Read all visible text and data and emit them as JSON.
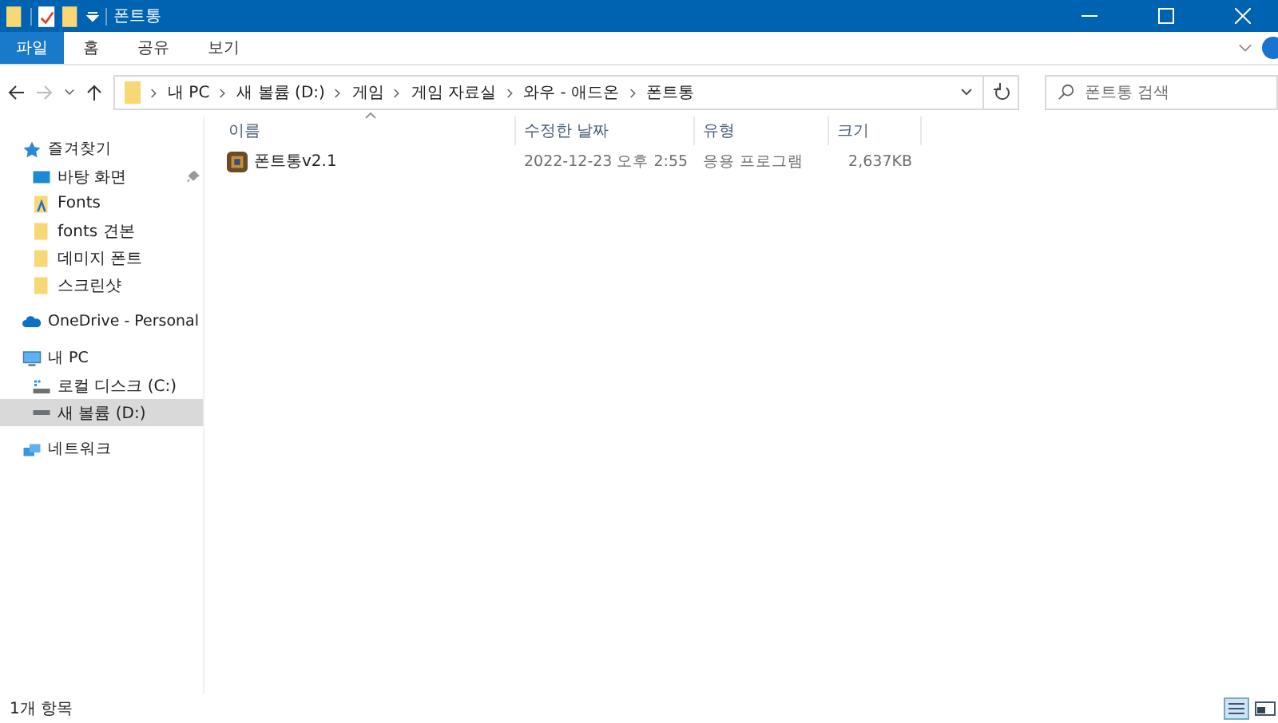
{
  "window": {
    "title": "폰트통"
  },
  "ribbon_tabs": [
    {
      "label": "파일",
      "selected": true
    },
    {
      "label": "홈",
      "selected": false
    },
    {
      "label": "공유",
      "selected": false
    },
    {
      "label": "보기",
      "selected": false
    }
  ],
  "address_bar": {
    "path": [
      "내 PC",
      "새 볼륨 (D:)",
      "게임",
      "게임 자료실",
      "와우 - 애드온",
      "폰트통"
    ]
  },
  "search": {
    "placeholder": "폰트통 검색"
  },
  "sidebar": {
    "items": [
      {
        "label": "즐겨찾기",
        "kind": "star",
        "selected": false,
        "children": [
          {
            "label": "바탕 화면",
            "kind": "desktop",
            "selected": false,
            "pinned": true
          },
          {
            "label": "Fonts",
            "kind": "font-folder",
            "selected": false,
            "pinned": false
          },
          {
            "label": "fonts  견본",
            "kind": "folder",
            "selected": false,
            "pinned": false
          },
          {
            "label": "데미지 폰트",
            "kind": "folder",
            "selected": false,
            "pinned": false
          },
          {
            "label": "스크린샷",
            "kind": "folder",
            "selected": false,
            "pinned": false
          }
        ]
      },
      {
        "label": "OneDrive - Personal",
        "kind": "cloud",
        "selected": false
      },
      {
        "label": "내 PC",
        "kind": "pc",
        "selected": false,
        "children": [
          {
            "label": "로컬 디스크 (C:)",
            "kind": "disk-system",
            "selected": false,
            "pinned": false
          },
          {
            "label": "새 볼륨 (D:)",
            "kind": "disk",
            "selected": true,
            "pinned": false
          }
        ]
      },
      {
        "label": "네트워크",
        "kind": "network",
        "selected": false
      }
    ]
  },
  "table": {
    "columns": [
      "이름",
      "수정한 날짜",
      "유형",
      "크기"
    ],
    "rows": [
      {
        "name": "폰트통v2.1",
        "modified": "2022-12-23 오후 2:55",
        "type": "응용 프로그램",
        "size": "2,637KB",
        "selected": false
      }
    ]
  },
  "status_bar": {
    "text": "1개 항목"
  }
}
